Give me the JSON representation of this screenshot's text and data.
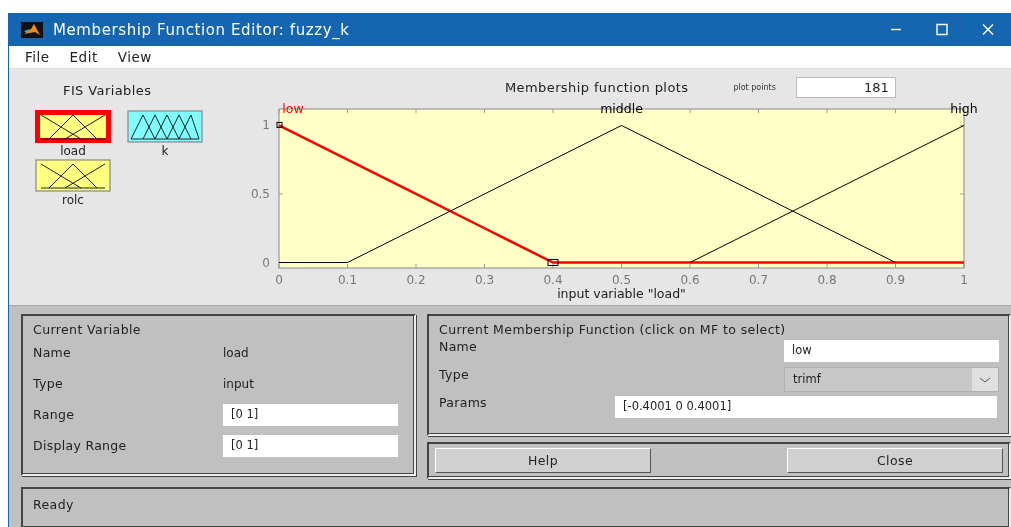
{
  "window": {
    "title": "Membership Function Editor: fuzzy_k"
  },
  "menu": [
    "File",
    "Edit",
    "View"
  ],
  "fis_variables": {
    "title": "FIS Variables",
    "items": [
      {
        "name": "load",
        "kind": "input",
        "selected": true
      },
      {
        "name": "k",
        "kind": "output",
        "selected": false
      },
      {
        "name": "rolc",
        "kind": "input",
        "selected": false
      }
    ]
  },
  "plot": {
    "plot_points_label": "plot points",
    "plot_points": "181",
    "chart_data": {
      "type": "line",
      "title": "Membership function plots",
      "xlabel": "input variable \"load\"",
      "x": [
        0,
        0.1,
        0.2,
        0.3,
        0.4,
        0.5,
        0.6,
        0.7,
        0.8,
        0.9,
        1
      ],
      "series": [
        {
          "name": "low",
          "color": "#ff0000",
          "values": [
            1,
            0.75,
            0.5,
            0.25,
            0,
            0,
            0,
            0,
            0,
            0,
            0
          ]
        },
        {
          "name": "middle",
          "color": "#000000",
          "values": [
            0,
            0,
            0.25,
            0.5,
            0.75,
            1,
            0.75,
            0.5,
            0.25,
            0,
            null
          ]
        },
        {
          "name": "high",
          "color": "#000000",
          "values": [
            null,
            null,
            null,
            null,
            null,
            null,
            0,
            0.25,
            0.5,
            0.75,
            1
          ]
        }
      ],
      "xlim": [
        0,
        1
      ],
      "ylim": [
        -0.04,
        1.12
      ],
      "xticks": [
        0,
        0.1,
        0.2,
        0.3,
        0.4,
        0.5,
        0.6,
        0.7,
        0.8,
        0.9,
        1
      ],
      "yticks": [
        0,
        0.5,
        1
      ]
    }
  },
  "current_variable": {
    "title": "Current Variable",
    "rows": [
      {
        "label": "Name",
        "value": "load",
        "kind": "text"
      },
      {
        "label": "Type",
        "value": "input",
        "kind": "text"
      },
      {
        "label": "Range",
        "value": "[0 1]",
        "kind": "field"
      },
      {
        "label": "Display Range",
        "value": "[0 1]",
        "kind": "field"
      }
    ]
  },
  "current_mf": {
    "title": "Current Membership Function (click on MF to select)",
    "rows": [
      {
        "label": "Name",
        "value": "low",
        "kind": "field"
      },
      {
        "label": "Type",
        "value": "trimf",
        "kind": "dropdown"
      },
      {
        "label": "Params",
        "value": "[-0.4001 0 0.4001]",
        "kind": "wide-field"
      }
    ]
  },
  "buttons": [
    "Help",
    "Close"
  ],
  "status_bar": "Ready"
}
